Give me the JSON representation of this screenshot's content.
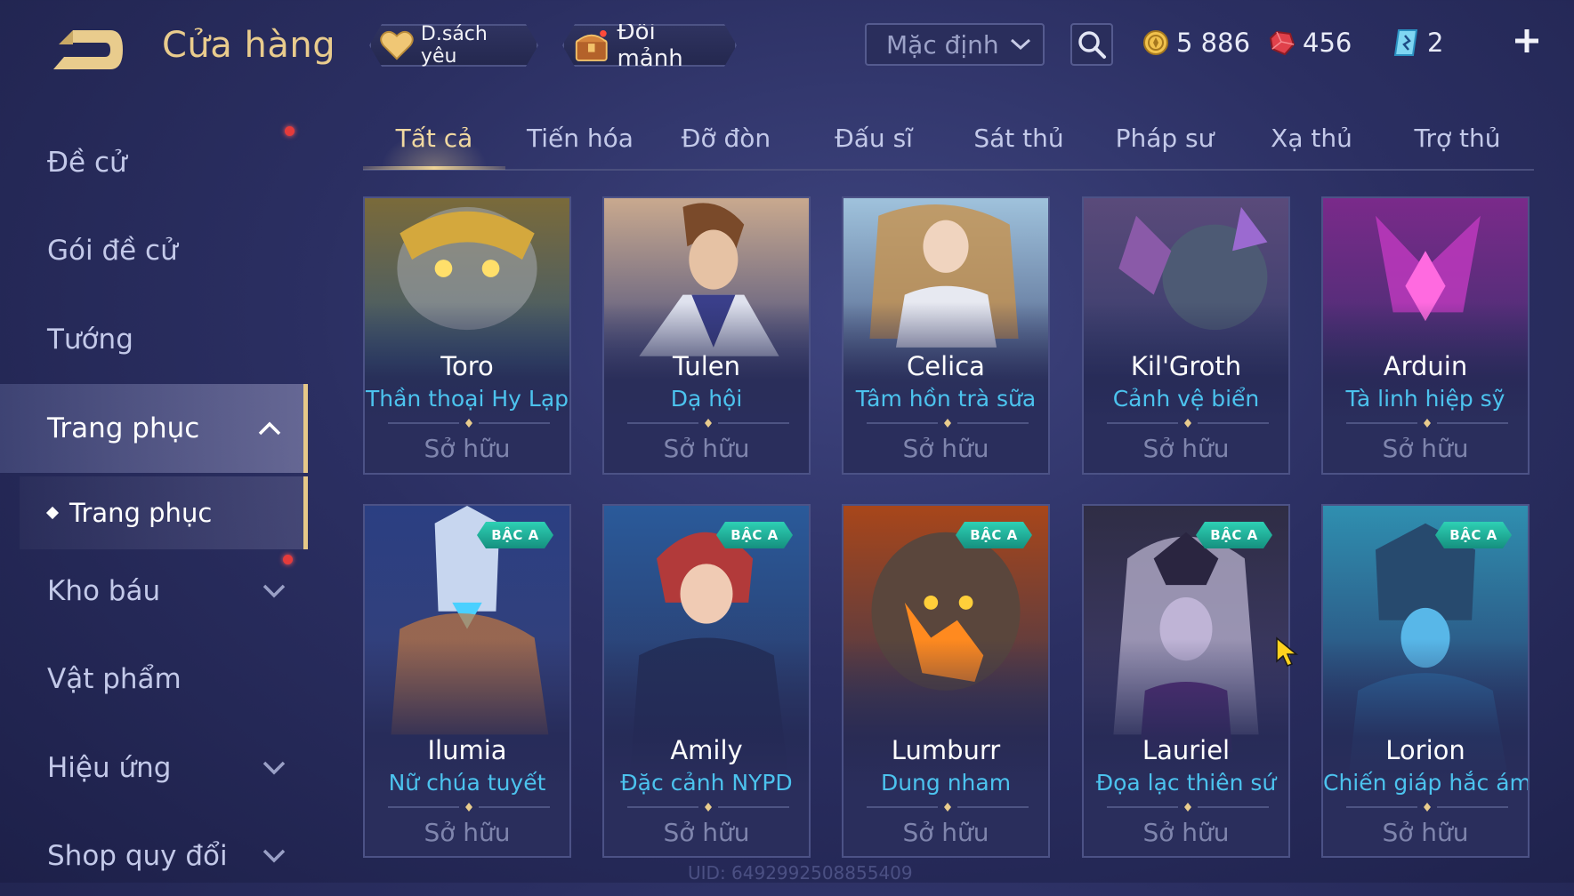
{
  "header": {
    "title": "Cửa hàng",
    "favorites_label": "D.sách yêu",
    "shard_exchange_label": "Đổi mảnh",
    "sort": {
      "selected": "Mặc định"
    },
    "currencies": {
      "gold": "5 886",
      "ruby": "456",
      "voucher": "2"
    }
  },
  "sidebar": {
    "items": [
      {
        "label": "Đề cử"
      },
      {
        "label": "Gói đề cử"
      },
      {
        "label": "Tướng"
      },
      {
        "label": "Trang phục"
      },
      {
        "label": "Kho báu"
      },
      {
        "label": "Vật phẩm"
      },
      {
        "label": "Hiệu ứng"
      },
      {
        "label": "Shop quy đổi"
      }
    ],
    "subitem": {
      "label": "Trang phục"
    }
  },
  "tabs": [
    {
      "label": "Tất cả"
    },
    {
      "label": "Tiến hóa"
    },
    {
      "label": "Đỡ đòn"
    },
    {
      "label": "Đấu sĩ"
    },
    {
      "label": "Sát thủ"
    },
    {
      "label": "Pháp sư"
    },
    {
      "label": "Xạ thủ"
    },
    {
      "label": "Trợ thủ"
    }
  ],
  "skins": [
    {
      "hero": "Toro",
      "skin": "Thần thoại Hy Lạp",
      "status": "Sở hữu",
      "tier": ""
    },
    {
      "hero": "Tulen",
      "skin": "Dạ hội",
      "status": "Sở hữu",
      "tier": ""
    },
    {
      "hero": "Celica",
      "skin": "Tâm hồn trà sữa",
      "status": "Sở hữu",
      "tier": ""
    },
    {
      "hero": "Kil'Groth",
      "skin": "Cảnh vệ biển",
      "status": "Sở hữu",
      "tier": ""
    },
    {
      "hero": "Arduin",
      "skin": "Tà linh hiệp sỹ",
      "status": "Sở hữu",
      "tier": ""
    },
    {
      "hero": "Ilumia",
      "skin": "Nữ chúa tuyết",
      "status": "Sở hữu",
      "tier": "BẬC A"
    },
    {
      "hero": "Amily",
      "skin": "Đặc cảnh NYPD",
      "status": "Sở hữu",
      "tier": "BẬC A"
    },
    {
      "hero": "Lumburr",
      "skin": "Dung nham",
      "status": "Sở hữu",
      "tier": "BẬC A"
    },
    {
      "hero": "Lauriel",
      "skin": "Đọa lạc thiên sứ",
      "status": "Sở hữu",
      "tier": "BẬC A"
    },
    {
      "hero": "Lorion",
      "skin": "Chiến giáp hắc ám",
      "status": "Sở hữu",
      "tier": "BẬC A"
    }
  ],
  "footer": {
    "uid": "UID: 6492992508855409"
  },
  "colors": {
    "accent_gold": "#e9cc8d",
    "skin_name_blue": "#4cc3ee",
    "tier_badge_teal": "#2ed0b4",
    "notification_red": "#e53b3b"
  }
}
